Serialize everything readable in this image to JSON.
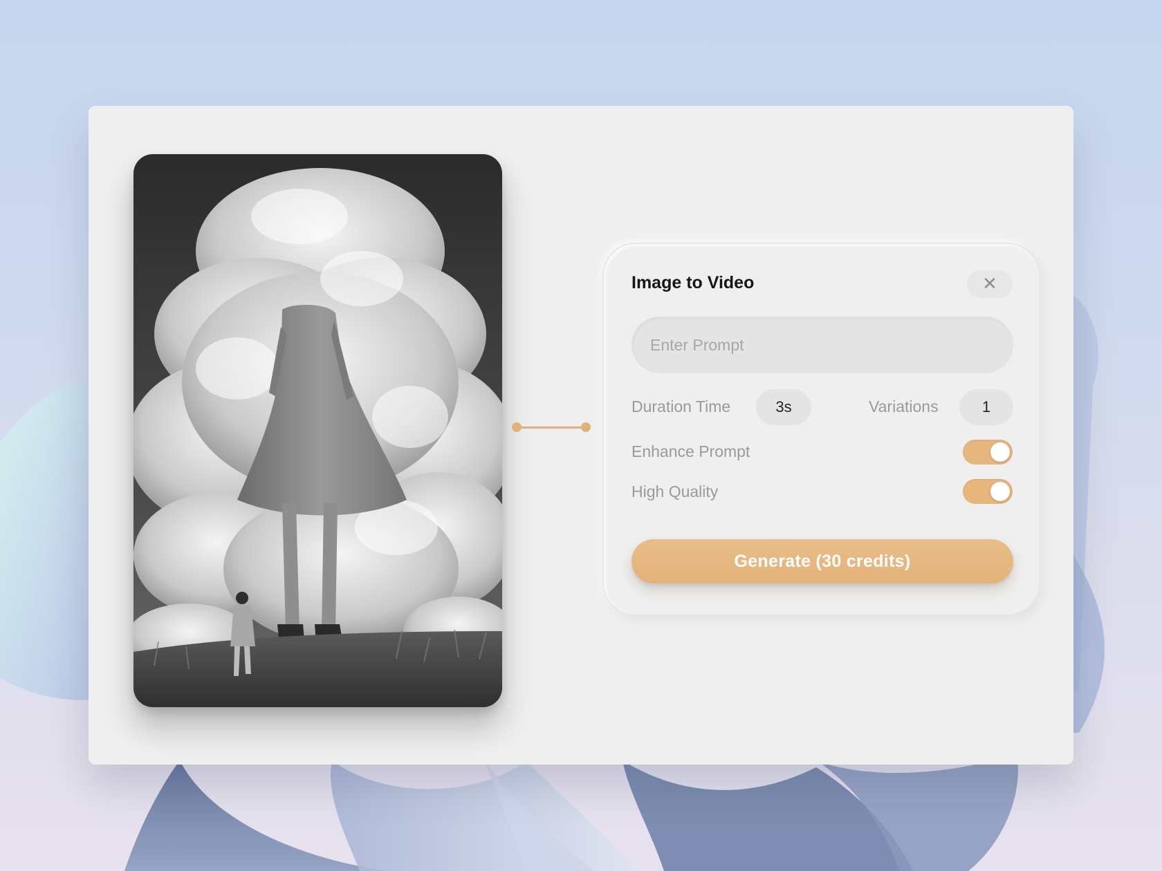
{
  "dialog": {
    "title": "Image to Video",
    "close_icon": "close-icon",
    "prompt_placeholder": "Enter Prompt",
    "prompt_value": "",
    "duration": {
      "label": "Duration Time",
      "value": "3s"
    },
    "variations": {
      "label": "Variations",
      "value": "1"
    },
    "enhance_prompt": {
      "label": "Enhance Prompt",
      "on": true
    },
    "high_quality": {
      "label": "High Quality",
      "on": true
    },
    "generate_label": "Generate (30 credits)"
  },
  "colors": {
    "accent": "#e6b67d",
    "window": "#efefef",
    "field": "#e4e4e4"
  }
}
